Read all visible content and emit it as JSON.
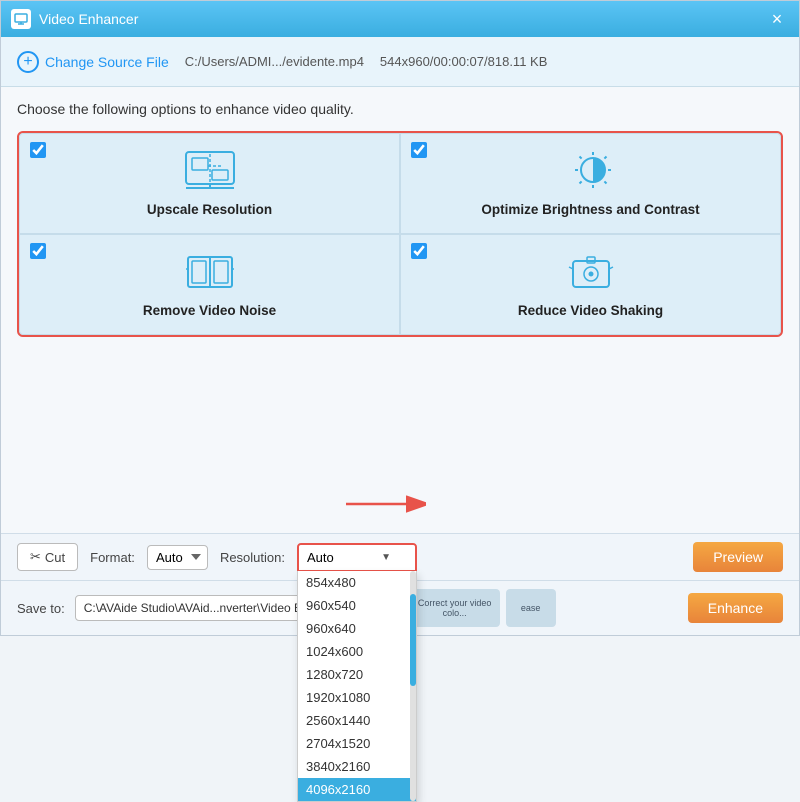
{
  "app": {
    "title": "Video Enhancer",
    "close_label": "×"
  },
  "toolbar": {
    "change_source_label": "Change Source File",
    "file_path": "C:/Users/ADMI.../evidente.mp4",
    "file_info": "544x960/00:00:07/818.11 KB"
  },
  "content": {
    "instructions": "Choose the following options to enhance video quality.",
    "options": [
      {
        "id": "upscale",
        "label": "Upscale Resolution",
        "checked": true,
        "icon": "monitor-upscale"
      },
      {
        "id": "brightness",
        "label": "Optimize Brightness and Contrast",
        "checked": true,
        "icon": "brightness"
      },
      {
        "id": "noise",
        "label": "Remove Video Noise",
        "checked": true,
        "icon": "film-noise"
      },
      {
        "id": "shaking",
        "label": "Reduce Video Shaking",
        "checked": true,
        "icon": "camera-shake"
      }
    ]
  },
  "bottom_bar": {
    "cut_label": "Cut",
    "format_label": "Format:",
    "format_value": "Auto",
    "resolution_label": "Resolution:",
    "resolution_value": "Auto",
    "preview_label": "Preview",
    "resolution_options": [
      "854x480",
      "960x540",
      "960x640",
      "1024x600",
      "1280x720",
      "1920x1080",
      "2560x1440",
      "2704x1520",
      "3840x2160",
      "4096x2160"
    ]
  },
  "save_bar": {
    "save_label": "Save to:",
    "save_path": "C:\\AVAide Studio\\AVAid...nverter\\Video Enhancer",
    "dots_label": "...",
    "enhance_label": "Enhance"
  },
  "thumbnails": [
    "Correct your video colo...",
    "ease"
  ]
}
